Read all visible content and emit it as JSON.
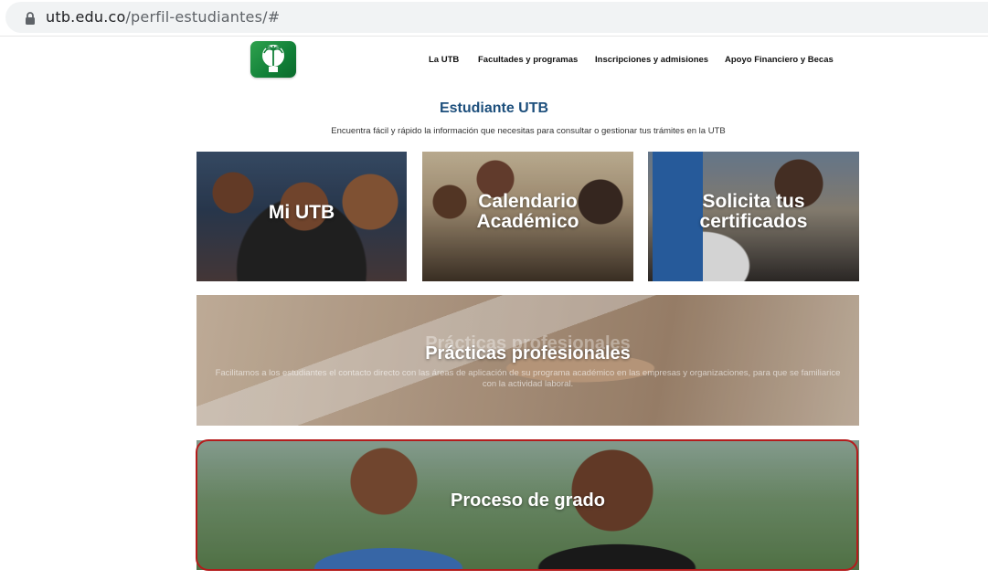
{
  "browser": {
    "domain": "utb.edu.co",
    "path": "/perfil-estudiantes/#"
  },
  "header": {
    "nav": [
      {
        "label": "La UTB"
      },
      {
        "label": "Facultades y programas"
      },
      {
        "label": "Inscripciones y admisiones"
      },
      {
        "label": "Apoyo Financiero y Becas"
      }
    ]
  },
  "page": {
    "title": "Estudiante UTB",
    "subtitle": "Encuentra fácil y rápido la información que necesitas para consultar o gestionar tus trámites en la UTB"
  },
  "tiles": [
    {
      "label": "Mi UTB"
    },
    {
      "line1": "Calendario",
      "line2": "Académico"
    },
    {
      "line1": "Solicita tus",
      "line2": "certificados"
    },
    {
      "label": "Prácticas profesionales",
      "description": "Facilitamos a los estudiantes el contacto directo con las áreas de aplicación de su programa académico en las empresas y organizaciones, para que se familiarice con la actividad laboral."
    },
    {
      "label": "Proceso de grado"
    }
  ],
  "colors": {
    "title": "#1d4f7c",
    "highlight": "#b41c1c",
    "logo_green": "#118038"
  }
}
